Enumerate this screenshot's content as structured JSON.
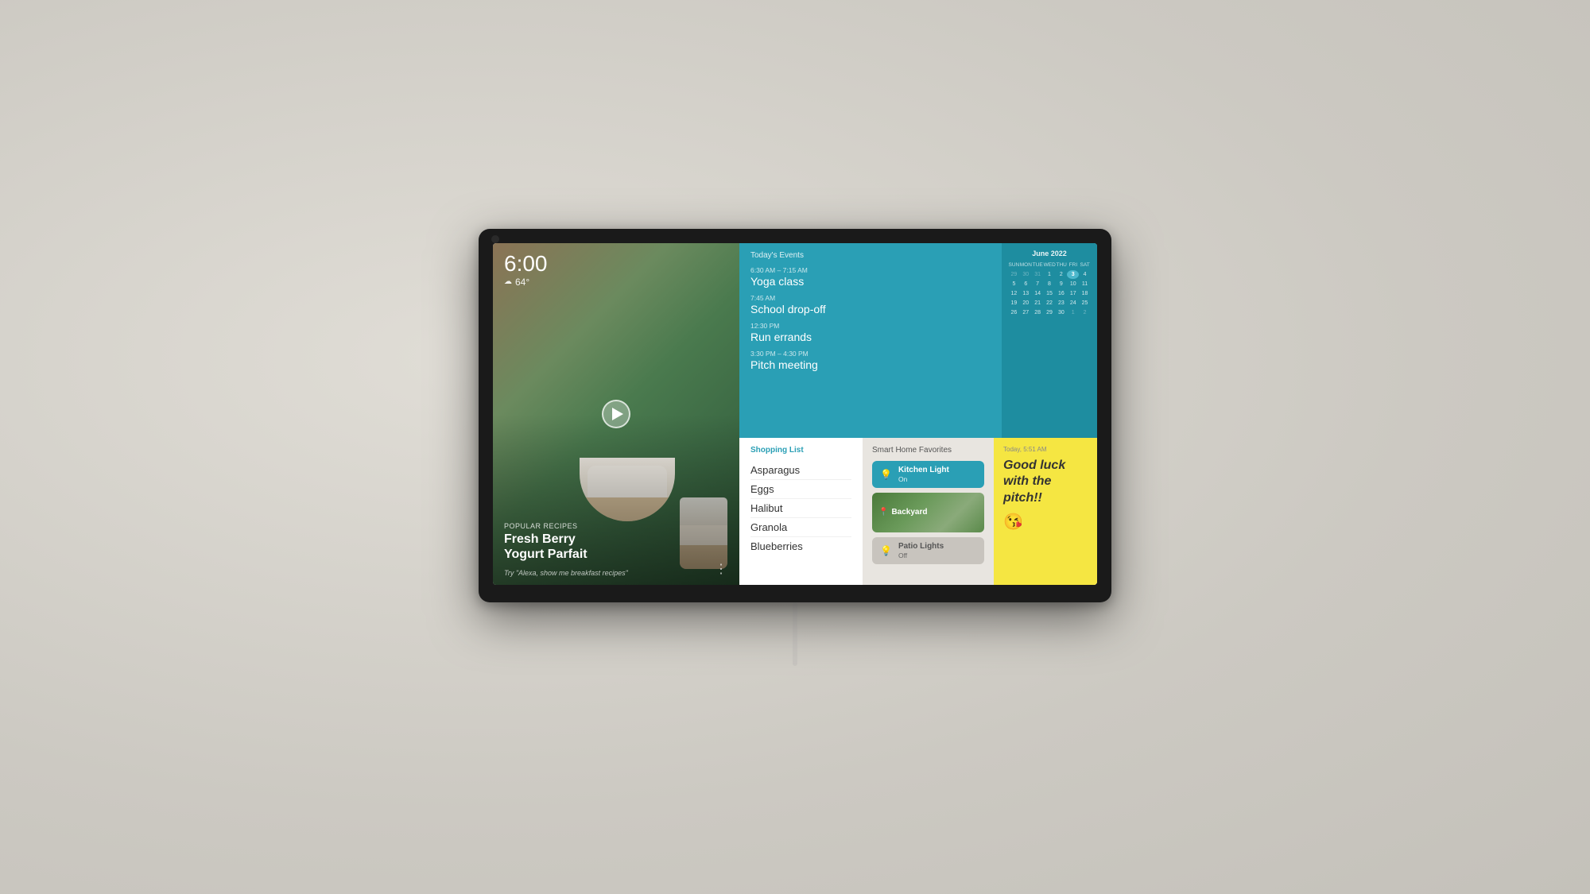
{
  "device": {
    "camera_dot": "camera"
  },
  "hero": {
    "time": "6:00",
    "weather_icon": "☁",
    "temperature": "64°",
    "recipe_category": "Popular Recipes",
    "recipe_name_line1": "Fresh Berry",
    "recipe_name_line2": "Yogurt Parfait",
    "suggestion": "Try \"Alexa, show me breakfast recipes\""
  },
  "events": {
    "title": "Today's Events",
    "items": [
      {
        "time": "6:30 AM – 7:15 AM",
        "name": "Yoga class"
      },
      {
        "time": "7:45 AM",
        "name": "School drop-off"
      },
      {
        "time": "12:30 PM",
        "name": "Run errands"
      },
      {
        "time": "3:30 PM – 4:30 PM",
        "name": "Pitch meeting"
      }
    ]
  },
  "calendar": {
    "title": "June 2022",
    "dow": [
      "SUN",
      "MON",
      "TUE",
      "WED",
      "THU",
      "FRI",
      "SAT"
    ],
    "weeks": [
      [
        "29",
        "30",
        "31",
        "1",
        "2",
        "3",
        "4"
      ],
      [
        "5",
        "6",
        "7",
        "8",
        "9",
        "10",
        "11"
      ],
      [
        "12",
        "13",
        "14",
        "15",
        "16",
        "17",
        "18"
      ],
      [
        "19",
        "20",
        "21",
        "22",
        "23",
        "24",
        "25"
      ],
      [
        "26",
        "27",
        "28",
        "29",
        "30",
        "1",
        "2"
      ]
    ],
    "today": "3",
    "today_week": 0,
    "today_col": 4
  },
  "shopping": {
    "title": "Shopping List",
    "items": [
      "Asparagus",
      "Eggs",
      "Halibut",
      "Granola",
      "Blueberries"
    ]
  },
  "smart_home": {
    "title": "Smart Home Favorites",
    "devices": [
      {
        "name": "Kitchen Light",
        "status": "On",
        "state": "on",
        "icon": "💡"
      },
      {
        "name": "Backyard",
        "status": "",
        "state": "camera",
        "icon": "📍"
      },
      {
        "name": "Patio Lights",
        "status": "Off",
        "state": "off",
        "icon": "💡"
      }
    ]
  },
  "note": {
    "time": "Today, 5:51 AM",
    "text": "Good luck with the pitch!!",
    "emoji": "😘"
  }
}
